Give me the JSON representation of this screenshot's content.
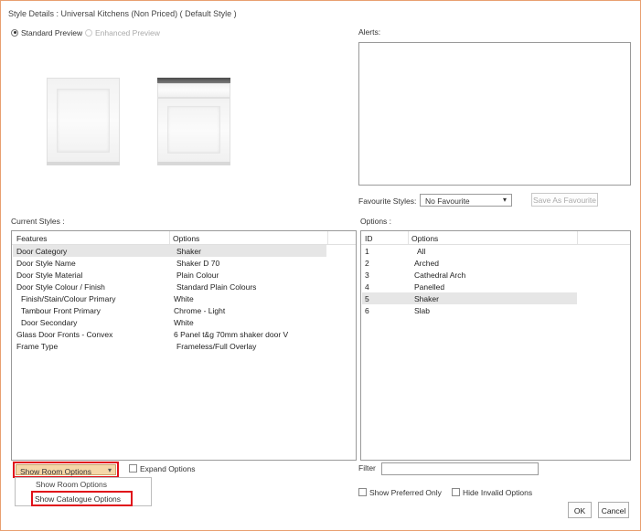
{
  "title": "Style Details : Universal Kitchens (Non Priced) ( Default Style )",
  "preview": {
    "standard_label": "Standard Preview",
    "enhanced_label": "Enhanced Preview"
  },
  "alerts_label": "Alerts:",
  "favourite": {
    "label": "Favourite Styles:",
    "selected": "No Favourite",
    "save_button": "Save As Favourite"
  },
  "current_styles": {
    "label": "Current Styles :",
    "columns": [
      "Features",
      "Options"
    ],
    "rows": [
      {
        "feature": "Door Category",
        "option": "Shaker"
      },
      {
        "feature": "Door Style Name",
        "option": "Shaker D 70"
      },
      {
        "feature": "Door Style Material",
        "option": "Plain Colour"
      },
      {
        "feature": "Door Style Colour / Finish",
        "option": "Standard Plain Colours"
      },
      {
        "feature": "Finish/Stain/Colour Primary",
        "option": "White"
      },
      {
        "feature": "Tambour Front Primary",
        "option": "Chrome - Light"
      },
      {
        "feature": "Door Secondary",
        "option": "White"
      },
      {
        "feature": "Glass Door Fronts - Convex",
        "option": "6 Panel t&g 70mm shaker door V"
      },
      {
        "feature": "Frame Type",
        "option": "Frameless/Full Overlay"
      }
    ]
  },
  "options": {
    "label": "Options :",
    "columns": [
      "ID",
      "Options"
    ],
    "rows": [
      {
        "id": "1",
        "option": "All"
      },
      {
        "id": "2",
        "option": "Arched"
      },
      {
        "id": "3",
        "option": "Cathedral Arch"
      },
      {
        "id": "4",
        "option": "Panelled"
      },
      {
        "id": "5",
        "option": "Shaker"
      },
      {
        "id": "6",
        "option": "Slab"
      }
    ]
  },
  "room_options": {
    "selected": "Show Room Options",
    "items": [
      "Show Room Options",
      "Show Catalogue Options"
    ]
  },
  "expand_options_label": "Expand Options",
  "filter_label": "Filter",
  "show_preferred_label": "Show Preferred Only",
  "hide_invalid_label": "Hide Invalid Options",
  "ok_label": "OK",
  "cancel_label": "Cancel",
  "colors": {
    "highlight_border": "#e0101a",
    "dropdown_bg": "#f5d7a8",
    "frame_border": "#e8a070"
  }
}
